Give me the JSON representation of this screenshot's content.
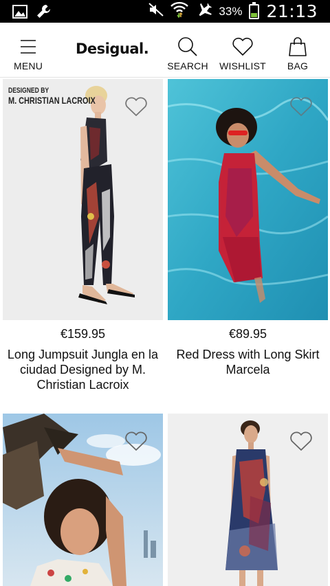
{
  "status_bar": {
    "battery_percent": "33%",
    "time": "21:13",
    "battery_level": 0.33
  },
  "header": {
    "logo": "Desigual.",
    "menu_label": "MENU",
    "search_label": "SEARCH",
    "wishlist_label": "WISHLIST",
    "bag_label": "BAG"
  },
  "products": [
    {
      "price": "€159.95",
      "name": "Long Jumpsuit Jungla en la ciudad Designed by M. Christian Lacroix",
      "badge_line1": "DESIGNED BY",
      "badge_line2": "M. CHRISTIAN LACROIX"
    },
    {
      "price": "€89.95",
      "name": "Red Dress with Long Skirt Marcela"
    },
    {
      "price": "",
      "name": ""
    },
    {
      "price": "",
      "name": ""
    }
  ],
  "colors": {
    "accent": "#111111",
    "status_bar": "#000000",
    "battery": "#7ec13a",
    "pool": "#2fa7c5"
  }
}
